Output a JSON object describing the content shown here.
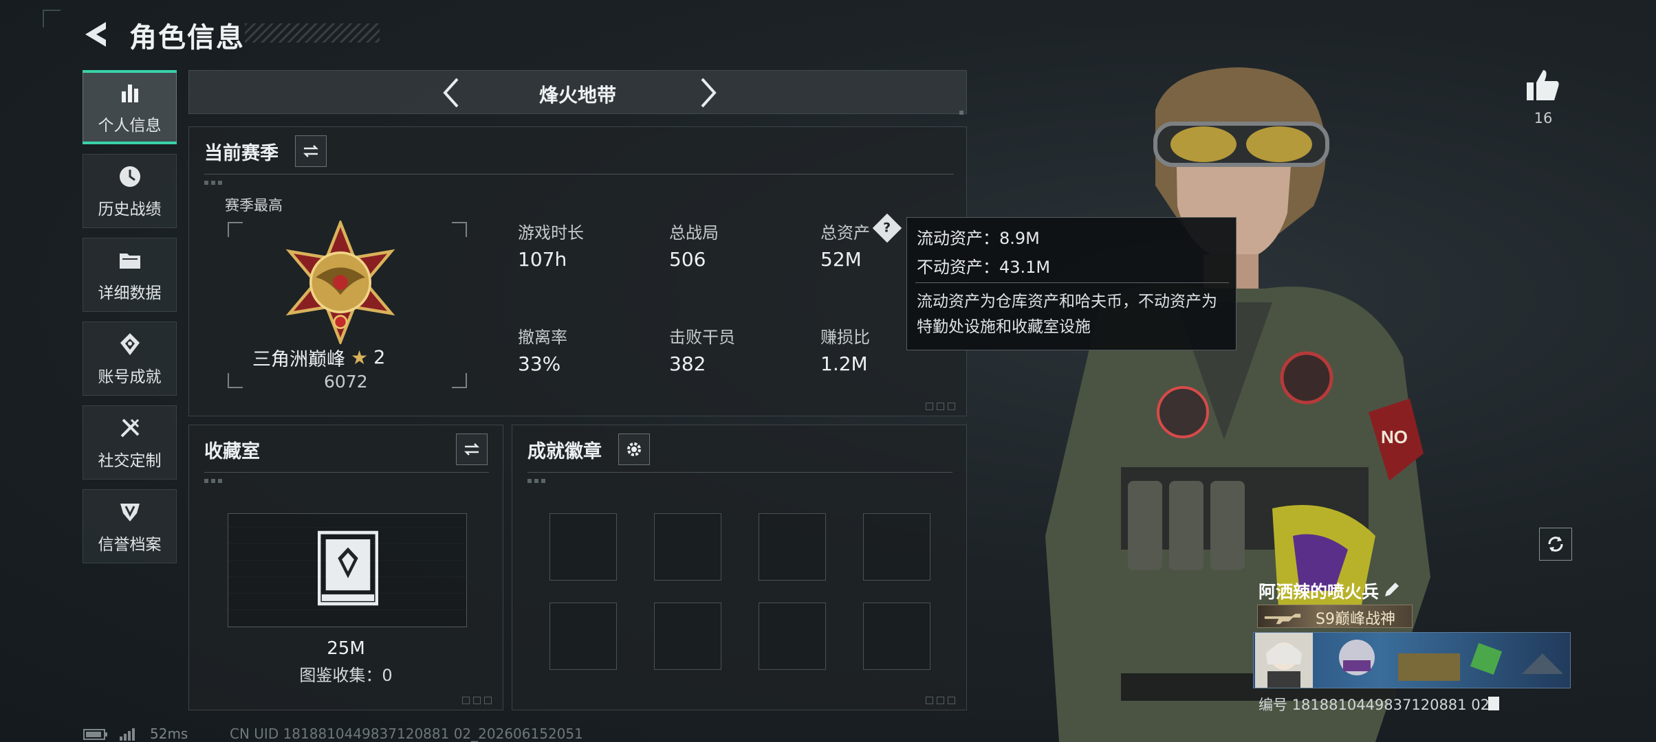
{
  "header": {
    "title": "角色信息"
  },
  "sidebar": {
    "items": [
      {
        "label": "个人信息",
        "icon": "bar-chart-icon",
        "active": true
      },
      {
        "label": "历史战绩",
        "icon": "clock-icon",
        "active": false
      },
      {
        "label": "详细数据",
        "icon": "folder-icon",
        "active": false
      },
      {
        "label": "账号成就",
        "icon": "achievement-icon",
        "active": false
      },
      {
        "label": "社交定制",
        "icon": "tools-icon",
        "active": false
      },
      {
        "label": "信誉档案",
        "icon": "shield-icon",
        "active": false
      }
    ]
  },
  "map_selector": {
    "name": "烽火地带"
  },
  "season": {
    "title": "当前赛季",
    "best_label": "赛季最高",
    "rank_name": "三角洲巅峰",
    "rank_star": "2",
    "rank_score": "6072",
    "stats": [
      {
        "label": "游戏时长",
        "value": "107h"
      },
      {
        "label": "总战局",
        "value": "506"
      },
      {
        "label": "总资产",
        "value": "52M"
      },
      {
        "label": "撤离率",
        "value": "33%"
      },
      {
        "label": "击败干员",
        "value": "382"
      },
      {
        "label": "赚损比",
        "value": "1.2M"
      }
    ]
  },
  "tooltip": {
    "liquid": "流动资产：8.9M",
    "fixed": "不动资产：43.1M",
    "description": "流动资产为仓库资产和哈夫币，不动资产为特勤处设施和收藏室设施"
  },
  "collection": {
    "title": "收藏室",
    "value": "25M",
    "catalog": "图鉴收集：0"
  },
  "badges": {
    "title": "成就徽章",
    "slots": 8
  },
  "profile": {
    "likes": "16",
    "player_name": "阿洒辣的喷火兵",
    "title_plate": "S9巅峰战神",
    "uid": "编号 1818810449837120881 02"
  },
  "status": {
    "ping": "52ms",
    "cn_uid": "CN UID 1818810449837120881 02_202606152051"
  },
  "colors": {
    "accent": "#3ad1a8",
    "gold": "#c9a24a"
  }
}
